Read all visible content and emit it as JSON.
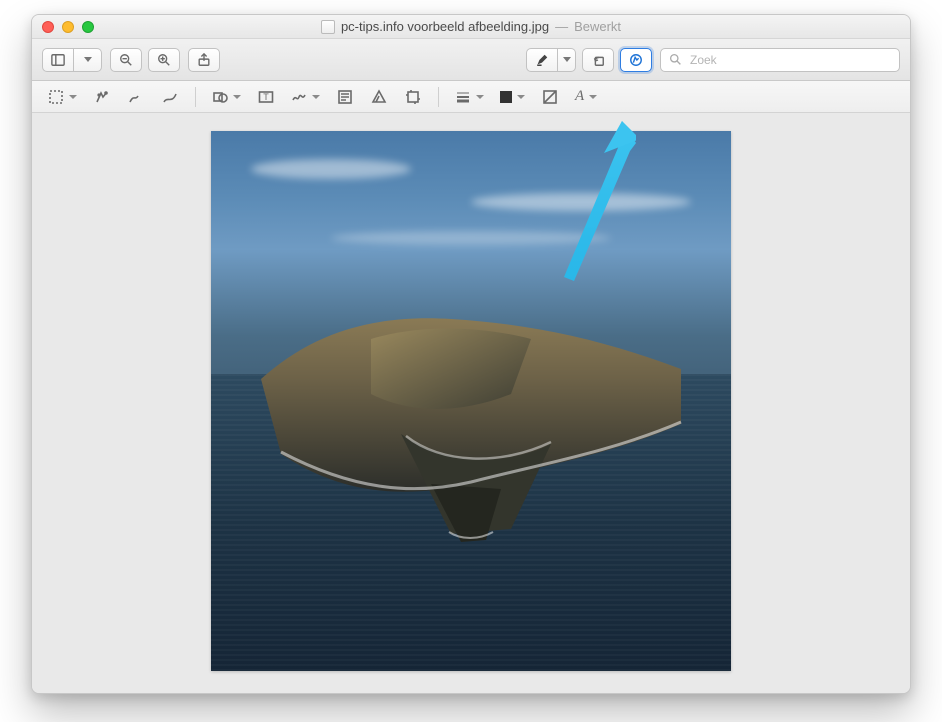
{
  "window": {
    "filename": "pc-tips.info voorbeeld afbeelding.jpg",
    "status_separator": "—",
    "status": "Bewerkt"
  },
  "toolbar": {
    "search_placeholder": "Zoek"
  },
  "icons": {
    "sidebar": "sidebar-icon",
    "zoom_out": "zoom-out-icon",
    "zoom_in": "zoom-in-icon",
    "share": "share-icon",
    "highlight": "highlighter-icon",
    "rotate": "rotate-left-icon",
    "markup": "markup-pen-icon",
    "search": "search-icon"
  },
  "markup_bar": {
    "tools": [
      "selection",
      "instant-alpha",
      "sketch",
      "draw",
      "shapes",
      "text",
      "sign",
      "note",
      "adjust-color",
      "crop",
      "line-style",
      "fill-color",
      "stroke-color",
      "text-style"
    ]
  },
  "annotation": {
    "arrow_color": "#29b7e8"
  },
  "image": {
    "description": "Catalina island aerial photo (macOS wallpaper style)"
  }
}
